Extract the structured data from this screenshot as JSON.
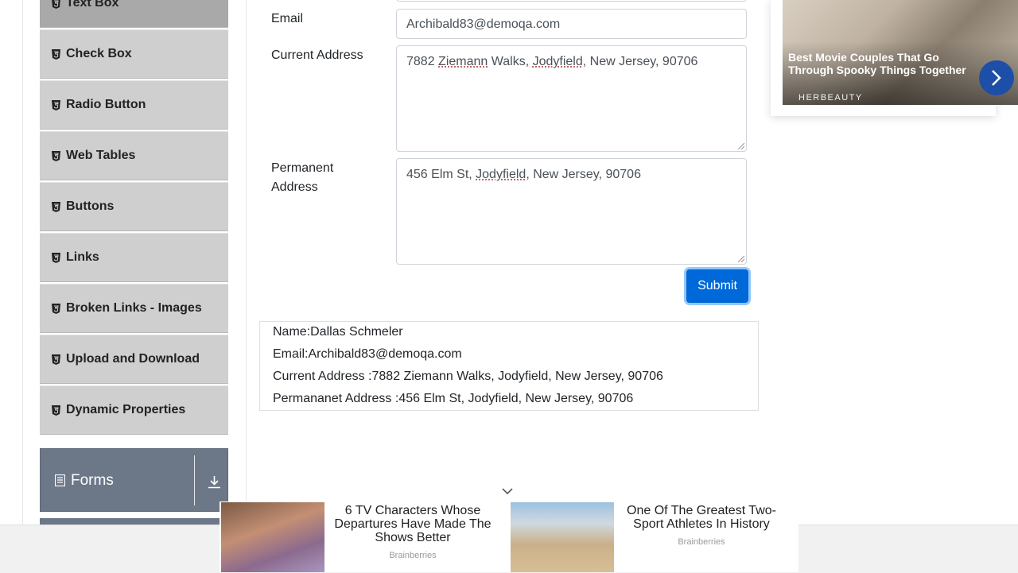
{
  "sidebar": {
    "items": [
      {
        "label": "Text Box"
      },
      {
        "label": "Check Box"
      },
      {
        "label": "Radio Button"
      },
      {
        "label": "Web Tables"
      },
      {
        "label": "Buttons"
      },
      {
        "label": "Links"
      },
      {
        "label": "Broken Links - Images"
      },
      {
        "label": "Upload and Download"
      },
      {
        "label": "Dynamic Properties"
      }
    ],
    "forms_group": {
      "label": "Forms"
    }
  },
  "form": {
    "email_label": "Email",
    "email_value": "Archibald83@demoqa.com",
    "current_address_label": "Current Address",
    "current_address_value": {
      "p1": "7882 ",
      "w1": "Ziemann",
      "p2": " Walks, ",
      "w2": "Jodyfield",
      "p3": ", New Jersey, 90706"
    },
    "permanent_address_label_1": "Permanent",
    "permanent_address_label_2": "Address",
    "permanent_address_value": {
      "p1": "456 Elm St, ",
      "w1": "Jodyfield",
      "p2": ", New Jersey, 90706"
    },
    "submit_label": "Submit"
  },
  "output": {
    "name": "Name:Dallas Schmeler",
    "email": "Email:Archibald83@demoqa.com",
    "current_address": "Current Address :7882 Ziemann Walks, Jodyfield, New Jersey, 90706",
    "permanent_address": "Permananet Address :456 Elm St, Jodyfield, New Jersey, 90706"
  },
  "right_ad": {
    "title": "Best Movie Couples That Go Through Spooky Things Together",
    "brand": "HERBEAUTY"
  },
  "bottom_ad": {
    "items": [
      {
        "title": "6 TV Characters Whose Departures Have Made The Shows Better",
        "source": "Brainberries"
      },
      {
        "title": "One Of The Greatest Two-Sport Athletes In History",
        "source": "Brainberries"
      }
    ]
  },
  "colors": {
    "submit": "#0069d9",
    "sidebar_item": "#cfcfcf",
    "sidebar_active": "#a9a9a9",
    "forms_group": "#6c7787"
  }
}
